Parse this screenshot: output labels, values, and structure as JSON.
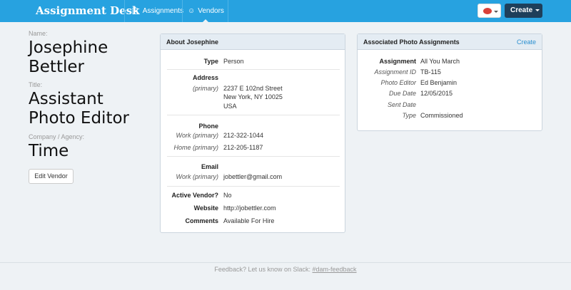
{
  "nav": {
    "brand": "Assignment Desk",
    "assignments": "Assignments",
    "vendors": "Vendors",
    "create": "Create",
    "assignments_icon": "clipboard-icon",
    "vendors_icon": "users-icon"
  },
  "vendor": {
    "name_label": "Name:",
    "name_line1": "Josephine",
    "name_line2": "Bettler",
    "title_label": "Title:",
    "title_line1": "Assistant",
    "title_line2": "Photo Editor",
    "company_label": "Company / Agency:",
    "company": "Time",
    "edit_button": "Edit Vendor"
  },
  "about": {
    "heading": "About Josephine",
    "type_label": "Type",
    "type_value": "Person",
    "address_label": "Address",
    "address_sub": "(primary)",
    "address_line1": "2237 E 102nd Street",
    "address_line2": "New York, NY 10025",
    "address_line3": "USA",
    "phone_label": "Phone",
    "phone1_label": "Work (primary)",
    "phone1_value": "212-322-1044",
    "phone2_label": "Home (primary)",
    "phone2_value": "212-205-1187",
    "email_label": "Email",
    "email1_label": "Work (primary)",
    "email1_value": "jobettler@gmail.com",
    "active_label": "Active Vendor?",
    "active_value": "No",
    "website_label": "Website",
    "website_value": "http://jobettler.com",
    "comments_label": "Comments",
    "comments_value": "Available For Hire"
  },
  "assignments_panel": {
    "heading": "Associated Photo Assignments",
    "create_link": "Create",
    "assignment_label": "Assignment",
    "assignment_value": "All You March",
    "id_label": "Assignment ID",
    "id_value": "TB-115",
    "editor_label": "Photo Editor",
    "editor_value": "Ed Benjamin",
    "due_label": "Due Date",
    "due_value": "12/05/2015",
    "sent_label": "Sent Date",
    "sent_value": "",
    "type_label": "Type",
    "type_value": "Commissioned"
  },
  "footer": {
    "text": "Feedback? Let us know on Slack:",
    "link": "#dam-feedback"
  },
  "colors": {
    "navbar": "#27a2e0",
    "create_button": "#1e3f5a",
    "link": "#2a8fd0",
    "panel_header": "#e4ecf3"
  }
}
